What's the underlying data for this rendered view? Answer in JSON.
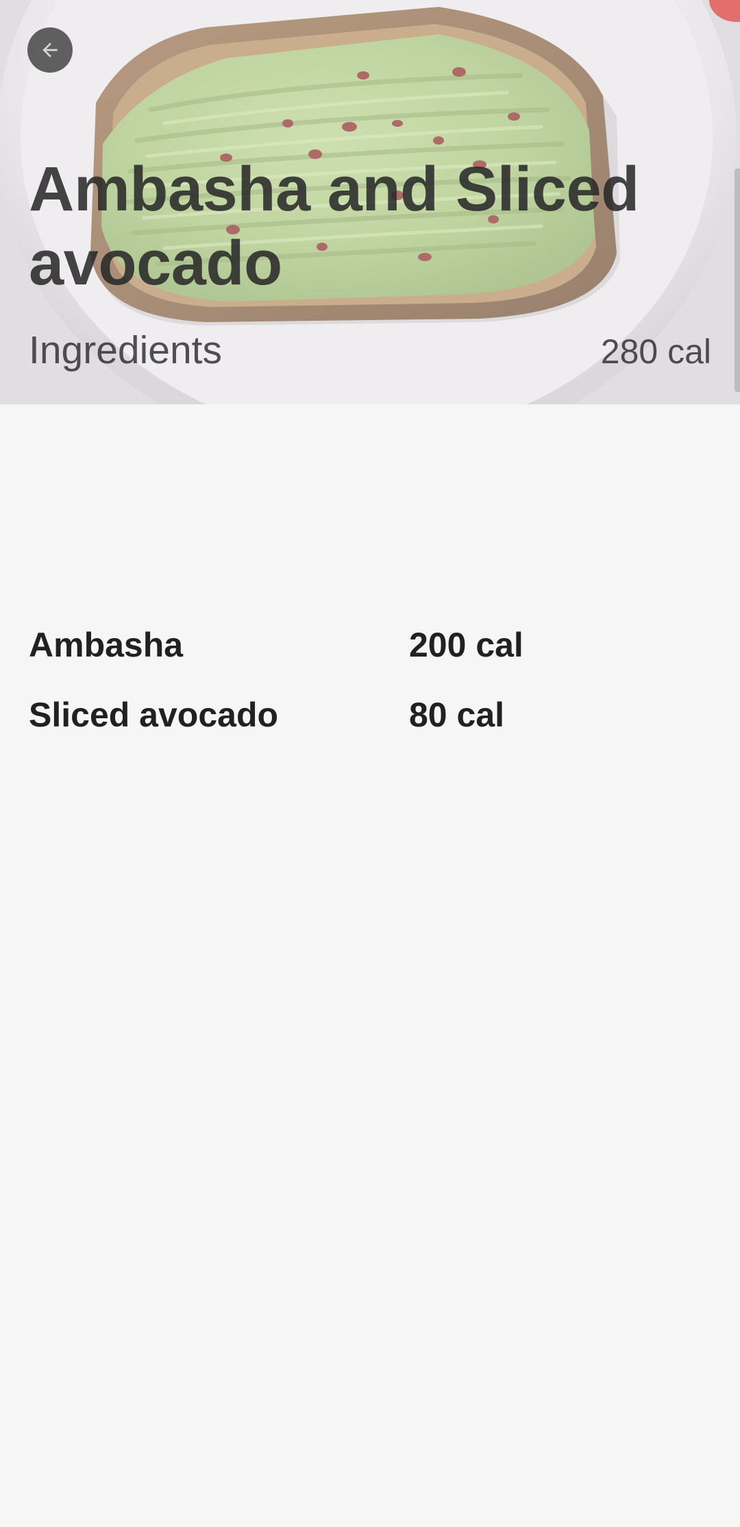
{
  "header": {
    "back_icon": "arrow-back-icon",
    "title": "Ambasha and Sliced avocado",
    "section_label": "Ingredients",
    "total_calories": "280 cal"
  },
  "hero_image": {
    "subject": "avocado-toast-photo"
  },
  "ingredients": [
    {
      "name": "Ambasha",
      "calories": "200 cal"
    },
    {
      "name": "Sliced avocado",
      "calories": "80 cal"
    }
  ],
  "colors": {
    "background": "#f6f6f6",
    "text": "#212121",
    "plate": "#e9e7ea",
    "avocado": "#a9c97a",
    "toast_crust": "#8a6440",
    "accent_red": "#d9322a"
  }
}
